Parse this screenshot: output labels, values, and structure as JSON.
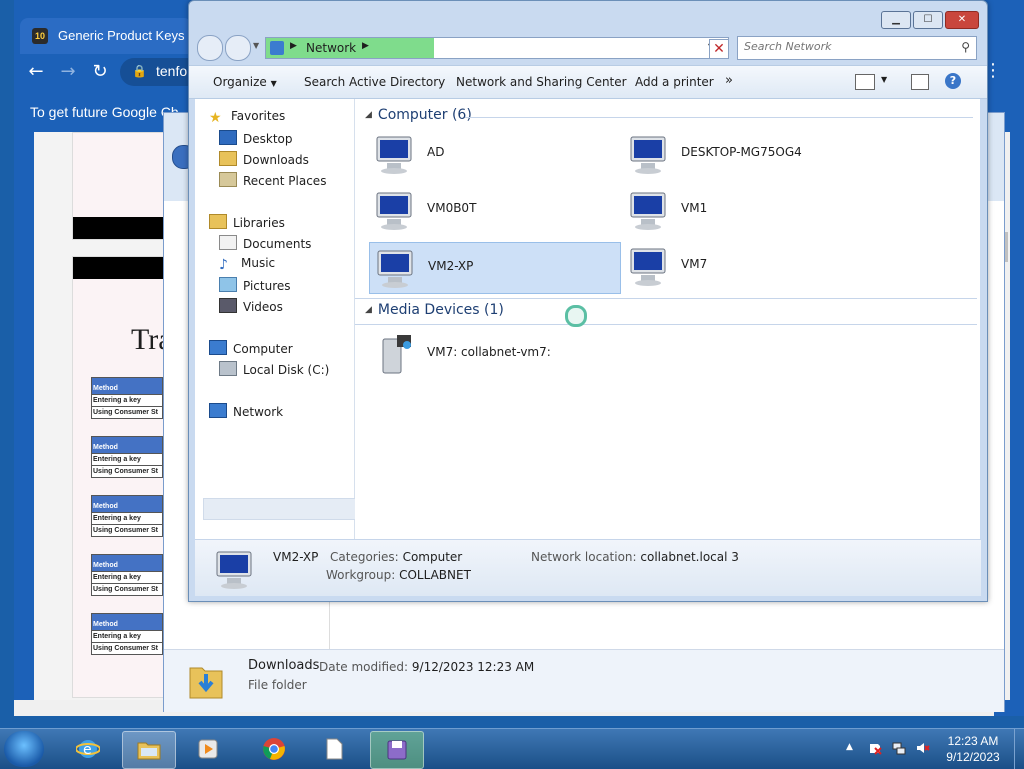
{
  "chrome": {
    "tab_title": "Generic Product Keys to",
    "tab_favicon_text": "10",
    "url_text": "tenfo",
    "infobar_text": "To get future Google Ch"
  },
  "background_doc": {
    "big_text": "Tra",
    "table_rows": [
      {
        "header": "Method",
        "r1": "Entering a key",
        "r2": "Using Consumer St"
      },
      {
        "header": "Method",
        "r1": "Entering a key",
        "r2": "Using Consumer St"
      },
      {
        "header": "Method",
        "r1": "Entering a key",
        "r2": "Using Consumer St"
      },
      {
        "header": "Method",
        "r1": "Entering a key",
        "r2": "Using Consumer St"
      },
      {
        "header": "Method",
        "r1": "Entering a key",
        "r2": "Using Consumer St"
      }
    ]
  },
  "explorer_back": {
    "downloads_name": "Downloads",
    "date_label": "Date modified:",
    "date_value": "9/12/2023 12:23 AM",
    "type": "File folder"
  },
  "explorer": {
    "address": {
      "current": "Network"
    },
    "search_placeholder": "Search Network",
    "commands": {
      "organize": "Organize",
      "search_ad": "Search Active Directory",
      "network_sharing": "Network and Sharing Center",
      "add_printer": "Add a printer",
      "more": "»"
    },
    "nav": {
      "favorites": "Favorites",
      "desktop": "Desktop",
      "downloads": "Downloads",
      "recent_places": "Recent Places",
      "libraries": "Libraries",
      "documents": "Documents",
      "music": "Music",
      "pictures": "Pictures",
      "videos": "Videos",
      "computer": "Computer",
      "local_disk": "Local Disk (C:)",
      "network": "Network"
    },
    "groups": {
      "computer": "Computer (6)",
      "media": "Media Devices (1)"
    },
    "computers": [
      "AD",
      "DESKTOP-MG75OG4",
      "VM0B0T",
      "VM1",
      "VM2-XP",
      "VM7"
    ],
    "media_devices": [
      "VM7: collabnet-vm7:"
    ],
    "details": {
      "name": "VM2-XP",
      "categories_label": "Categories:",
      "categories_value": "Computer",
      "workgroup_label": "Workgroup:",
      "workgroup_value": "COLLABNET",
      "netloc_label": "Network location:",
      "netloc_value": "collabnet.local  3"
    }
  },
  "taskbar": {
    "time": "12:23 AM",
    "date": "9/12/2023",
    "tray_arrow": "▲"
  }
}
